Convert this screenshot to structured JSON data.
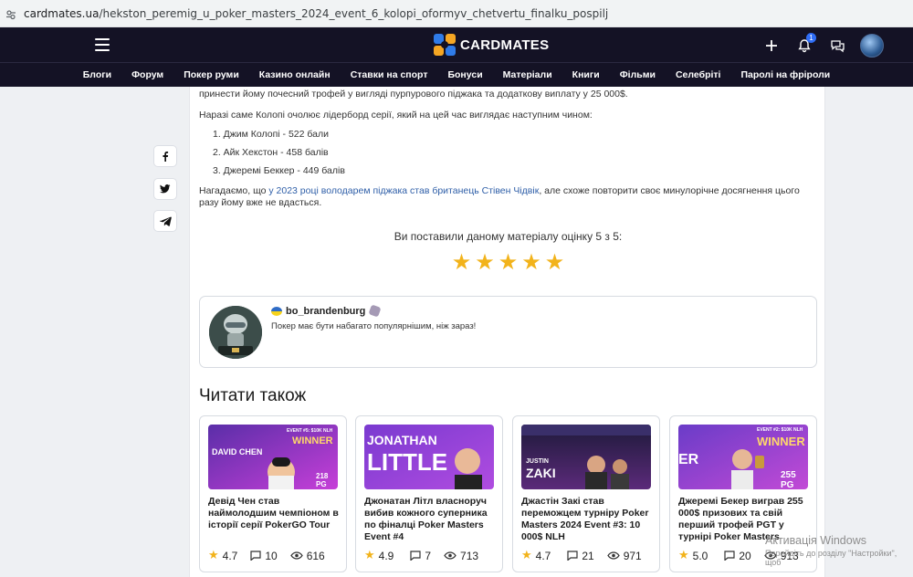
{
  "browser": {
    "url_host": "cardmates.ua",
    "url_path": "/hekston_peremig_u_poker_masters_2024_event_6_kolopi_oformyv_chetvertu_finalku_pospilj"
  },
  "header": {
    "logo_text": "CARDMATES",
    "notification_count": "1"
  },
  "menu": [
    "Блоги",
    "Форум",
    "Покер руми",
    "Казино онлайн",
    "Ставки на спорт",
    "Бонуси",
    "Матеріали",
    "Книги",
    "Фільми",
    "Селебріті",
    "Паролі на фріроли"
  ],
  "article": {
    "p1": "принести йому почесний трофей у вигляді пурпурового піджака та додаткову виплату у 25 000$.",
    "p2": "Наразі саме Колопі очолює лідерборд серії, який на цей час виглядає наступним чином:",
    "list": [
      "1. Джим Колопі - 522 бали",
      "2. Айк Хекстон - 458 балів",
      "3. Джеремі Беккер - 449 балів"
    ],
    "p3_before": "Нагадаємо, що ",
    "p3_link": "у 2023 році володарем піджака став британець Стівен Чідвік",
    "p3_after": ", але схоже повторити своє минулорічне досягнення цього разу йому вже не вдасться."
  },
  "rating": {
    "text": "Ви поставили даному матеріалу оцінку 5 з 5:",
    "stars": 5,
    "max": 5
  },
  "comment": {
    "username": "bo_brandenburg",
    "text": "Покер має бути набагато популярнішим, ніж зараз!"
  },
  "read_also": {
    "title": "Читати також",
    "cards": [
      {
        "title": "Девід Чен став наймолодшим чемпіоном в історії серії PokerGO Tour",
        "rating": "4.7",
        "comments": "10",
        "views": "616",
        "img_name": "DAVID CHEN",
        "img_badge": "WINNER",
        "img_event": "EVENT #5: $10K NLH",
        "img_prize": "218 PG"
      },
      {
        "title": "Джонатан Літл власноруч вибив кожного суперника по фіналці Poker Masters Event #4",
        "rating": "4.9",
        "comments": "7",
        "views": "713",
        "img_name1": "JONATHAN",
        "img_name2": "LITTLE"
      },
      {
        "title": "Джастін Закі став переможцем турніру Poker Masters 2024 Event #3: 10 000$ NLH",
        "rating": "4.7",
        "comments": "21",
        "views": "971",
        "img_name1": "JUSTIN",
        "img_name2": "ZAKI"
      },
      {
        "title": "Джеремі Бекер виграв 255 000$ призових та свій перший трофей PGT у турнірі Poker Masters",
        "rating": "5.0",
        "comments": "20",
        "views": "913",
        "img_name": "ER",
        "img_badge": "WINNER",
        "img_event": "EVENT #2: $10K NLH",
        "img_prize": "255 PG"
      }
    ]
  },
  "os_watermark": {
    "line1": "Активація Windows",
    "line2": "Перейдіть до розділу \"Настройки\", щоб"
  },
  "colors": {
    "header_bg": "#141225",
    "accent_blue": "#2f6df6",
    "star": "#f2b31b",
    "link": "#2f5fa8"
  }
}
